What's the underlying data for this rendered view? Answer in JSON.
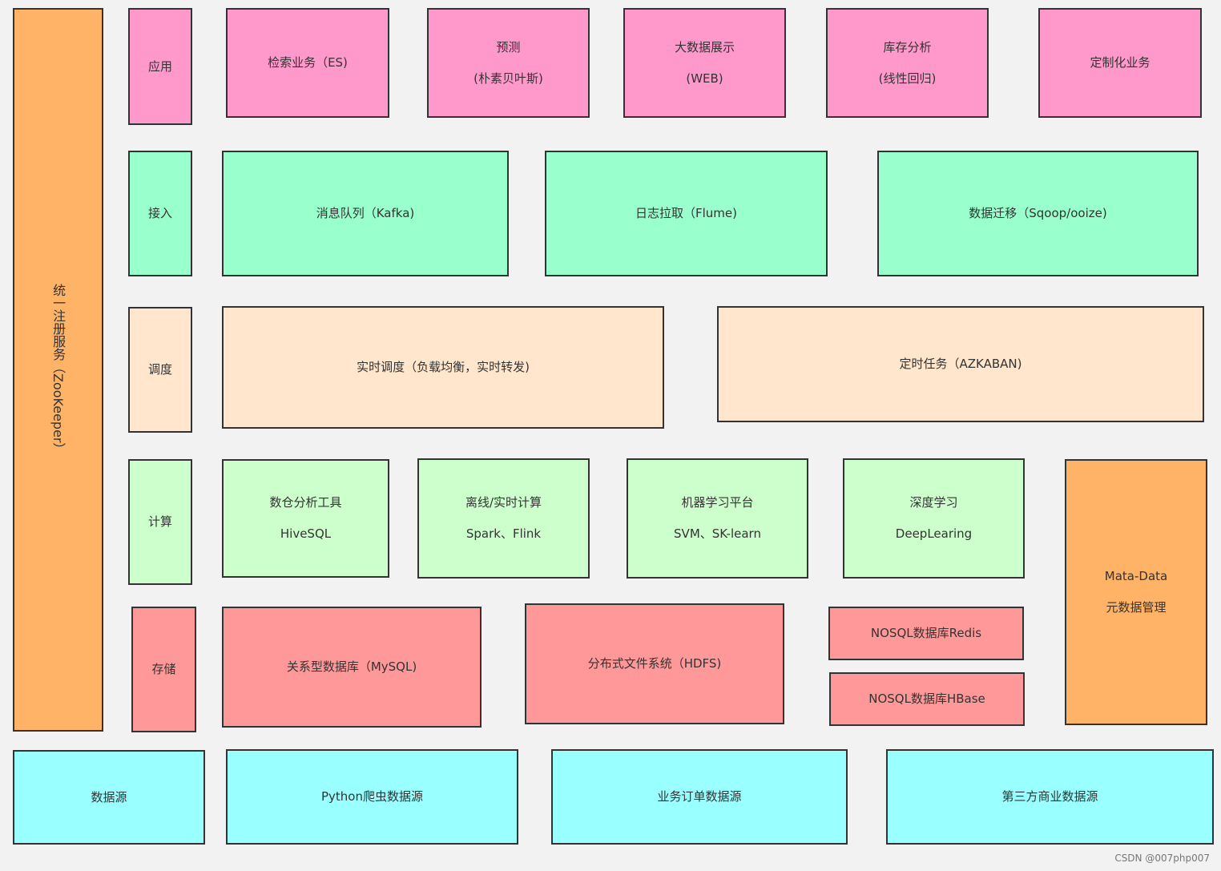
{
  "colors": {
    "background": "#f2f2f2",
    "application": "#ff99cc",
    "access": "#99ffcc",
    "scheduling": "#ffe6cc",
    "compute": "#ccffcc",
    "storage": "#ff9999",
    "registry": "#ffb366",
    "source": "#99ffff",
    "border": "#333333"
  },
  "registry": {
    "label": "统一注册服务（ZooKeeper）"
  },
  "application": {
    "layer": "应用",
    "items": [
      {
        "line1": "检索业务（ES)"
      },
      {
        "line1": "预测",
        "line2": "(朴素贝叶斯)"
      },
      {
        "line1": "大数据展示",
        "line2": "(WEB)"
      },
      {
        "line1": "库存分析",
        "line2": "(线性回归)"
      },
      {
        "line1": "定制化业务"
      }
    ]
  },
  "access": {
    "layer": "接入",
    "items": [
      {
        "line1": "消息队列（Kafka)"
      },
      {
        "line1": "日志拉取（Flume)"
      },
      {
        "line1": "数据迁移（Sqoop/ooize)"
      }
    ]
  },
  "scheduling": {
    "layer": "调度",
    "items": [
      {
        "line1": "实时调度（负载均衡，实时转发)"
      },
      {
        "line1": "定时任务（AZKABAN)"
      }
    ]
  },
  "compute": {
    "layer": "计算",
    "items": [
      {
        "line1": "数仓分析工具",
        "line2": "HiveSQL"
      },
      {
        "line1": "离线/实时计算",
        "line2": "Spark、Flink"
      },
      {
        "line1": "机器学习平台",
        "line2": "SVM、SK-learn"
      },
      {
        "line1": "深度学习",
        "line2": "DeepLearing"
      }
    ]
  },
  "metadata": {
    "line1": "Mata-Data",
    "line2": "元数据管理"
  },
  "storage": {
    "layer": "存储",
    "items": [
      {
        "line1": "关系型数据库（MySQL)"
      },
      {
        "line1": "分布式文件系统（HDFS)"
      },
      {
        "line1": "NOSQL数据库Redis"
      },
      {
        "line1": "NOSQL数据库HBase"
      }
    ]
  },
  "source": {
    "layer": "数据源",
    "items": [
      {
        "line1": "Python爬虫数据源"
      },
      {
        "line1": "业务订单数据源"
      },
      {
        "line1": "第三方商业数据源"
      }
    ]
  },
  "watermark": "CSDN @007php007"
}
